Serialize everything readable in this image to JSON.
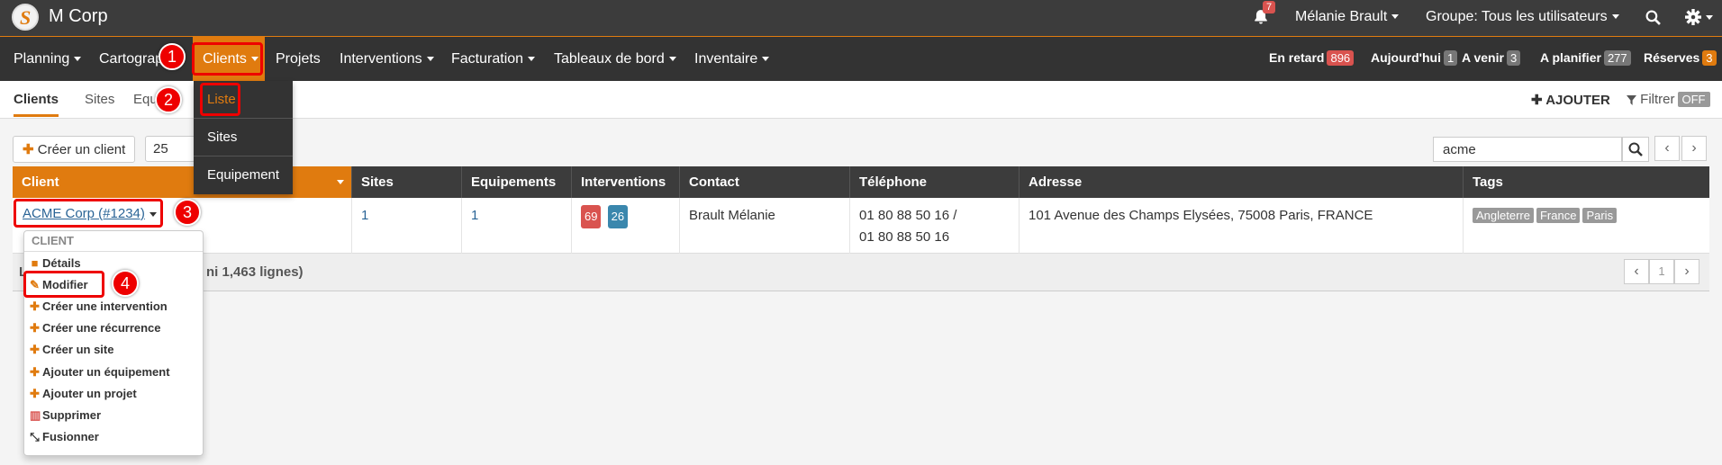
{
  "app": {
    "title": "M Corp",
    "logo_letter": "S",
    "notification_count": "7",
    "user": "Mélanie Brault",
    "group": "Groupe: Tous les utilisateurs"
  },
  "nav": {
    "items": [
      "Planning",
      "Cartograp",
      "Clients",
      "Projets",
      "Interventions",
      "Facturation",
      "Tableaux de bord",
      "Inventaire"
    ]
  },
  "stats": [
    {
      "label": "En retard",
      "value": "896",
      "color": "#d9534f"
    },
    {
      "label": "Aujourd'hui",
      "value": "1",
      "color": "#777777"
    },
    {
      "label": "A venir",
      "value": "3",
      "color": "#777777"
    },
    {
      "label": "A planifier",
      "value": "277",
      "color": "#777777"
    },
    {
      "label": "Réserves",
      "value": "3",
      "color": "#e07b0f"
    }
  ],
  "subnav": {
    "tabs": [
      "Clients",
      "Sites",
      "Equ"
    ],
    "add_label": "AJOUTER",
    "filter_label": "Filtrer",
    "filter_state": "OFF"
  },
  "toolbar": {
    "create_label": "Créer un client",
    "page_size": "25",
    "search_value": "acme"
  },
  "table": {
    "headers": [
      "Client",
      "Sites",
      "Equipements",
      "Interventions",
      "Contact",
      "Téléphone",
      "Adresse",
      "Tags"
    ],
    "row": {
      "client": "ACME Corp (#1234)",
      "sites": "1",
      "equipements": "1",
      "interventions_red": "69",
      "interventions_blue": "26",
      "contact": "Brault Mélanie",
      "phone1": "01 80 88 50 16 /",
      "phone2": "01 80 88 50 16",
      "address": "101 Avenue des Champs Elysées, 75008 Paris, FRANCE",
      "tags": [
        "Angleterre",
        "France",
        "Paris"
      ]
    },
    "footer_prefix": "L",
    "footer_text": "ni 1,463 lignes)",
    "page": "1"
  },
  "clients_menu": [
    "Liste",
    "Sites",
    "Equipement"
  ],
  "client_menu": {
    "header": "CLIENT",
    "items": [
      "Détails",
      "Modifier",
      "Créer une intervention",
      "Créer une récurrence",
      "Créer un site",
      "Ajouter un équipement",
      "Ajouter un projet",
      "Supprimer",
      "Fusionner"
    ]
  },
  "annotations": [
    "1",
    "2",
    "3",
    "4"
  ]
}
